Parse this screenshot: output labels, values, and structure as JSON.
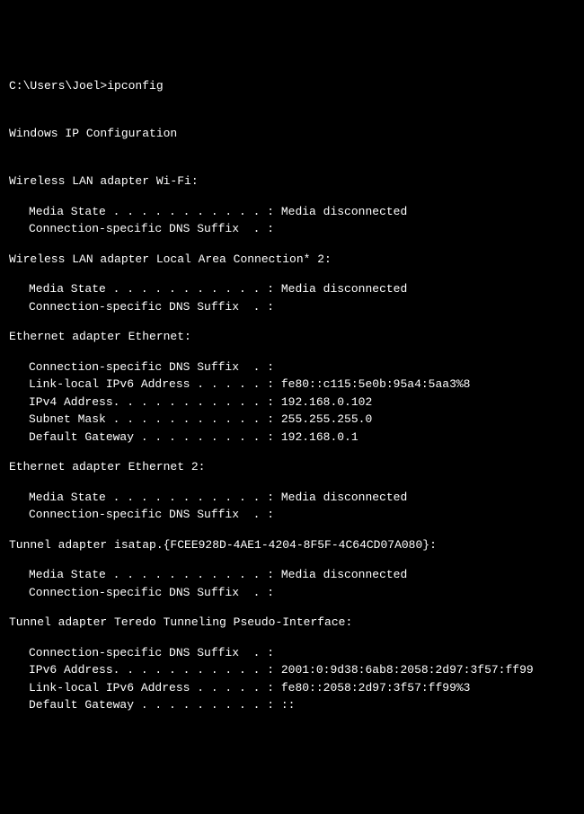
{
  "prompt": "C:\\Users\\Joel>ipconfig",
  "header": "Windows IP Configuration",
  "adapters": [
    {
      "name": "Wireless LAN adapter Wi-Fi:",
      "fields": [
        "Media State . . . . . . . . . . . : Media disconnected",
        "Connection-specific DNS Suffix  . :"
      ]
    },
    {
      "name": "Wireless LAN adapter Local Area Connection* 2:",
      "fields": [
        "Media State . . . . . . . . . . . : Media disconnected",
        "Connection-specific DNS Suffix  . :"
      ]
    },
    {
      "name": "Ethernet adapter Ethernet:",
      "fields": [
        "Connection-specific DNS Suffix  . :",
        "Link-local IPv6 Address . . . . . : fe80::c115:5e0b:95a4:5aa3%8",
        "IPv4 Address. . . . . . . . . . . : 192.168.0.102",
        "Subnet Mask . . . . . . . . . . . : 255.255.255.0",
        "Default Gateway . . . . . . . . . : 192.168.0.1"
      ]
    },
    {
      "name": "Ethernet adapter Ethernet 2:",
      "fields": [
        "Media State . . . . . . . . . . . : Media disconnected",
        "Connection-specific DNS Suffix  . :"
      ]
    },
    {
      "name": "Tunnel adapter isatap.{FCEE928D-4AE1-4204-8F5F-4C64CD07A080}:",
      "fields": [
        "Media State . . . . . . . . . . . : Media disconnected",
        "Connection-specific DNS Suffix  . :"
      ]
    },
    {
      "name": "Tunnel adapter Teredo Tunneling Pseudo-Interface:",
      "fields": [
        "Connection-specific DNS Suffix  . :",
        "IPv6 Address. . . . . . . . . . . : 2001:0:9d38:6ab8:2058:2d97:3f57:ff99",
        "Link-local IPv6 Address . . . . . : fe80::2058:2d97:3f57:ff99%3",
        "Default Gateway . . . . . . . . . : ::"
      ]
    }
  ]
}
